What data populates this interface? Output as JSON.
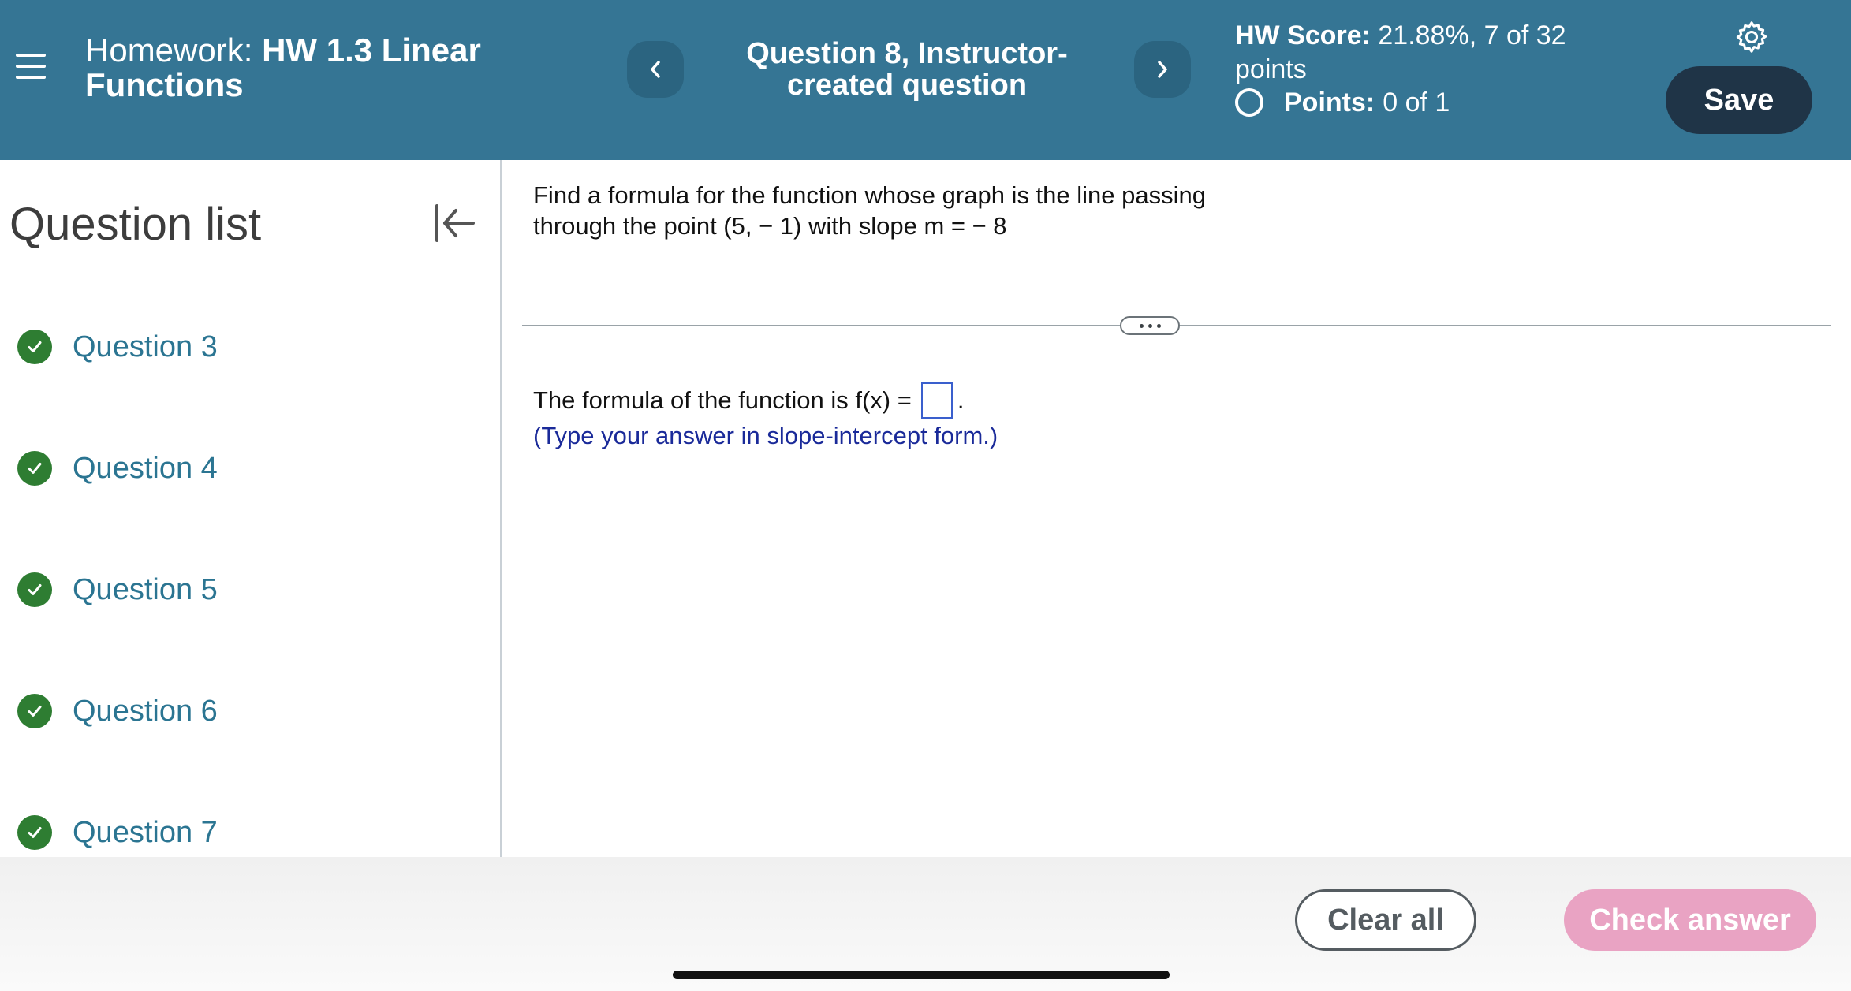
{
  "header": {
    "homework_prefix": "Homework:",
    "homework_name": "HW 1.3 Linear Functions",
    "question_title": "Question 8, Instructor-created question",
    "hw_score_label": "HW Score:",
    "hw_score_value": "21.88%, 7 of 32 points",
    "points_label": "Points:",
    "points_value": "0 of 1",
    "save_label": "Save",
    "icons": {
      "menu": "hamburger-menu-icon",
      "prev": "chevron-left-icon",
      "next": "chevron-right-icon",
      "settings": "gear-icon"
    }
  },
  "sidebar": {
    "title": "Question list",
    "collapse_icon": "collapse-left-icon",
    "items": [
      {
        "label": "Question 3",
        "status": "complete"
      },
      {
        "label": "Question 4",
        "status": "complete"
      },
      {
        "label": "Question 5",
        "status": "complete"
      },
      {
        "label": "Question 6",
        "status": "complete"
      },
      {
        "label": "Question 7",
        "status": "complete"
      }
    ]
  },
  "main": {
    "prompt_line1": "Find a formula for the function whose graph is the line passing",
    "prompt_line2": "through the point (5,  − 1) with slope m =  − 8",
    "answer_prefix": "The formula of the function is f(x) =",
    "answer_suffix": ".",
    "answer_value": "",
    "hint": "(Type your answer in slope-intercept form.)"
  },
  "footer": {
    "clear_label": "Clear all",
    "check_label": "Check answer"
  },
  "colors": {
    "header_bg": "#357594",
    "save_bg": "#1f3447",
    "check_icon": "#2e7d32",
    "question_link": "#2b7592",
    "hint_text": "#1a2a99",
    "check_answer_bg": "#e9a3c3"
  }
}
